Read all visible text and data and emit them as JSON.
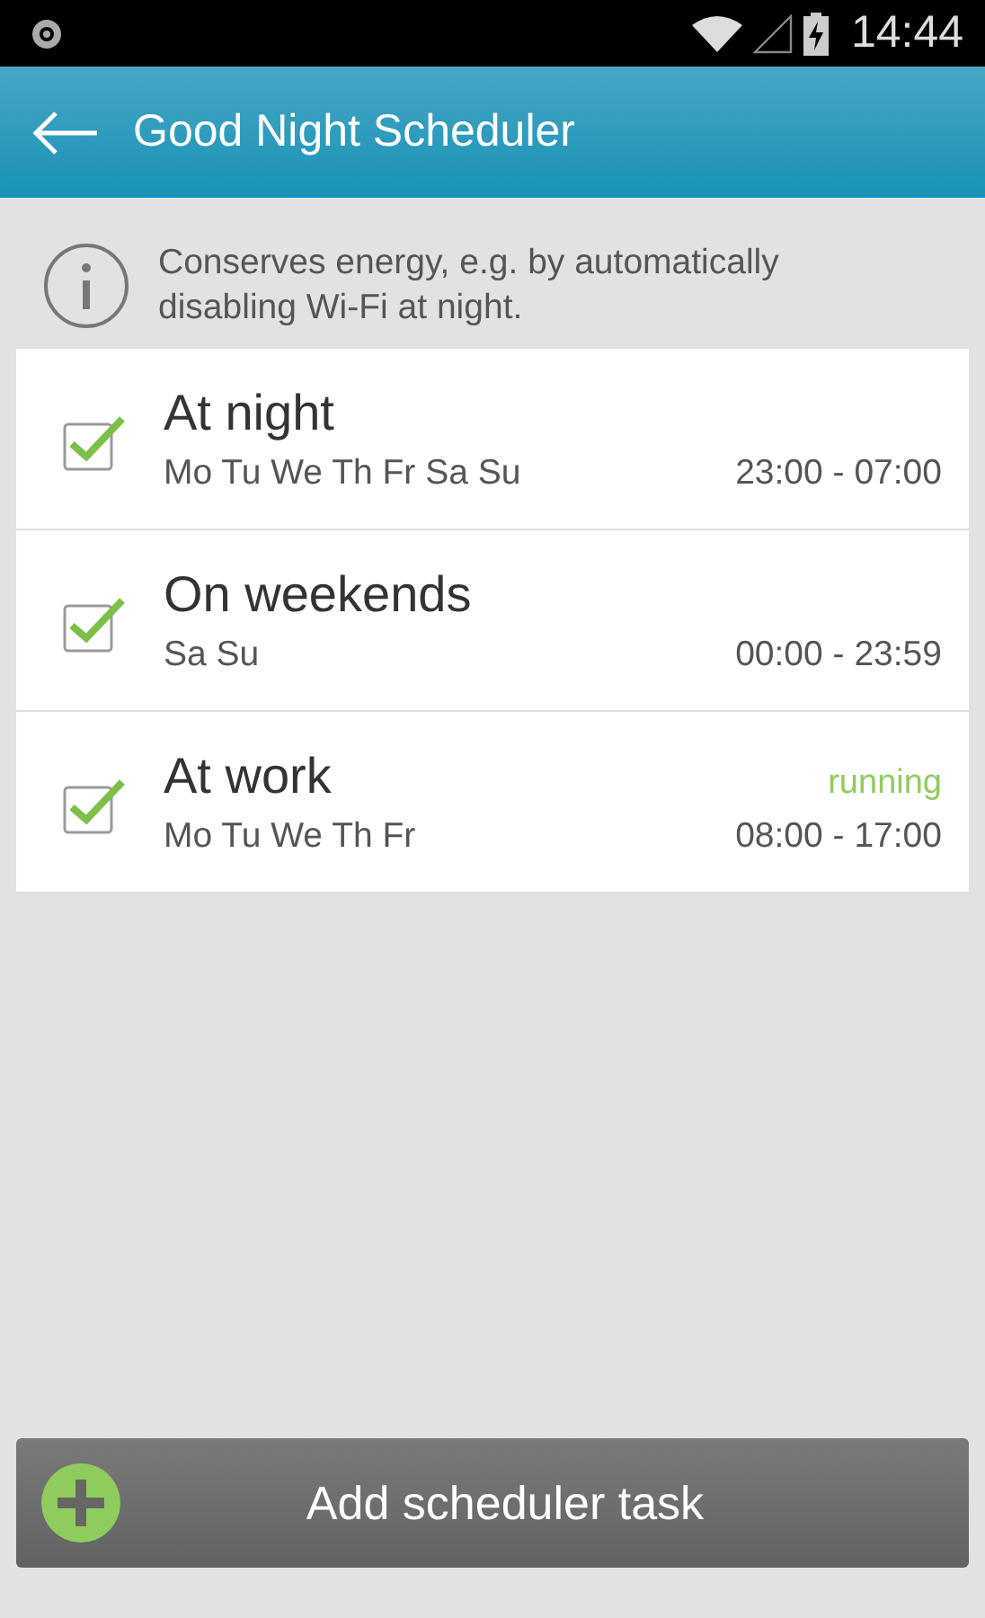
{
  "status_bar": {
    "time": "14:44"
  },
  "app_bar": {
    "title": "Good Night Scheduler"
  },
  "info": {
    "text": "Conserves energy, e.g. by automatically disabling Wi-Fi at night."
  },
  "tasks": [
    {
      "name": "At night",
      "days": "Mo Tu We Th Fr Sa Su",
      "time": "23:00 - 07:00",
      "checked": true
    },
    {
      "name": "On weekends",
      "days": "Sa Su",
      "time": "00:00 - 23:59",
      "checked": true
    },
    {
      "name": "At work",
      "days": "Mo Tu We Th Fr",
      "time": "08:00 - 17:00",
      "checked": true,
      "status": "running"
    }
  ],
  "add_button": {
    "label": "Add scheduler task"
  }
}
